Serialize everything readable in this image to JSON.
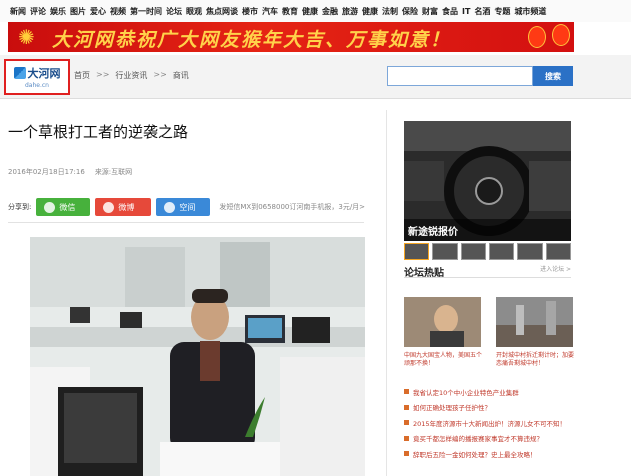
{
  "topnav": [
    "新闻",
    "评论",
    "娱乐",
    "图片",
    "爱心",
    "视频",
    "第一时间",
    "论坛",
    "眼观",
    "焦点网谈",
    "楼市",
    "汽车",
    "教育",
    "健康",
    "金融",
    "旅游",
    "健康",
    "法制",
    "保险",
    "财富",
    "食品",
    "IT",
    "名酒",
    "专题",
    "城市频道"
  ],
  "banner": {
    "text": "大河网恭祝广大网友猴年大吉、万事如意！"
  },
  "logo": {
    "name": "大河网",
    "sub": "dahe.cn"
  },
  "breadcrumb": [
    "首页",
    "行业资讯",
    "商讯"
  ],
  "breadcrumb_sep": ">>",
  "search": {
    "placeholder": "",
    "button": "搜索"
  },
  "article": {
    "title": "一个草根打工者的逆袭之路",
    "date": "2016年02月18日17:16",
    "source": "来源:互联网"
  },
  "share": {
    "label": "分享到:",
    "wechat": "微信",
    "weibo": "微博",
    "qzone": "空间",
    "note": "发短信MX到0658000订河南手机报，3元/月>"
  },
  "sidebar": {
    "car_caption": "新途锐报价",
    "forum_title": "论坛热贴",
    "forum_more": "进入论坛 >",
    "img1_caption": "中国九大国宝人物，美国五个顽那不换！",
    "img2_caption": "开封城中村拆迁剩计时；加要恋痛吾剩城中村！",
    "list": [
      "我省认定10个中小企业特色产业集群",
      "如何正确处理孩子任护性？",
      "2015年度济源市十大新闻出炉！济源儿女不可不知！",
      "竟买千都怎样编的播报赛家事宜才不算违规？",
      "辞职后五险一金如何处理？史上最全攻略！"
    ]
  },
  "colors": {
    "accent": "#2b71c6",
    "banner": "#d31010",
    "link_red": "#c0392b",
    "logo_border": "#e02020"
  }
}
